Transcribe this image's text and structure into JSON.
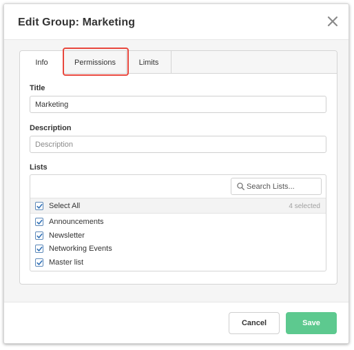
{
  "modal": {
    "title": "Edit Group: Marketing",
    "close_icon": "close-icon"
  },
  "tabs": [
    {
      "label": "Info",
      "active": true
    },
    {
      "label": "Permissions",
      "active": false,
      "highlighted": true
    },
    {
      "label": "Limits",
      "active": false
    }
  ],
  "form": {
    "title_label": "Title",
    "title_value": "Marketing",
    "description_label": "Description",
    "description_placeholder": "Description",
    "description_value": "",
    "lists_label": "Lists"
  },
  "lists": {
    "search_placeholder": "Search Lists...",
    "search_icon": "search-icon",
    "select_all_label": "Select All",
    "select_all_checked": true,
    "selected_count": "4 selected",
    "items": [
      {
        "label": "Announcements",
        "checked": true
      },
      {
        "label": "Newsletter",
        "checked": true
      },
      {
        "label": "Networking Events",
        "checked": true
      },
      {
        "label": "Master list",
        "checked": true
      }
    ]
  },
  "footer": {
    "cancel_label": "Cancel",
    "save_label": "Save"
  },
  "colors": {
    "save_button": "#5dc98f",
    "highlight": "#e8463c",
    "checkbox_border": "#5b87b8",
    "checkmark": "#2f6fb5"
  }
}
